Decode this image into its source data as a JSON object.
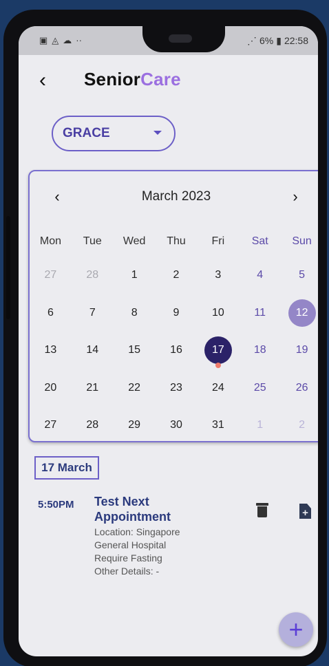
{
  "status": {
    "left_icons": [
      "image-icon",
      "mask-icon",
      "cloud-icon",
      "dots-icon"
    ],
    "right_text": "6%",
    "time": "22:58"
  },
  "header": {
    "title_a": "Senior",
    "title_b": "Care"
  },
  "dropdown": {
    "value": "GRACE"
  },
  "calendar": {
    "month_label": "March 2023",
    "weekdays": [
      "Mon",
      "Tue",
      "Wed",
      "Thu",
      "Fri",
      "Sat",
      "Sun"
    ],
    "weeks": [
      [
        "27",
        "28",
        "1",
        "2",
        "3",
        "4",
        "5"
      ],
      [
        "6",
        "7",
        "8",
        "9",
        "10",
        "11",
        "12"
      ],
      [
        "13",
        "14",
        "15",
        "16",
        "17",
        "18",
        "19"
      ],
      [
        "20",
        "21",
        "22",
        "23",
        "24",
        "25",
        "26"
      ],
      [
        "27",
        "28",
        "29",
        "30",
        "31",
        "1",
        "2"
      ]
    ]
  },
  "selected_date_label": "17 March",
  "appointment": {
    "time": "5:50PM",
    "title": "Test Next Appointment",
    "location": "Location: Singapore General Hospital",
    "note": "Require Fasting",
    "other": "Other Details: -"
  },
  "fab_label": "+"
}
